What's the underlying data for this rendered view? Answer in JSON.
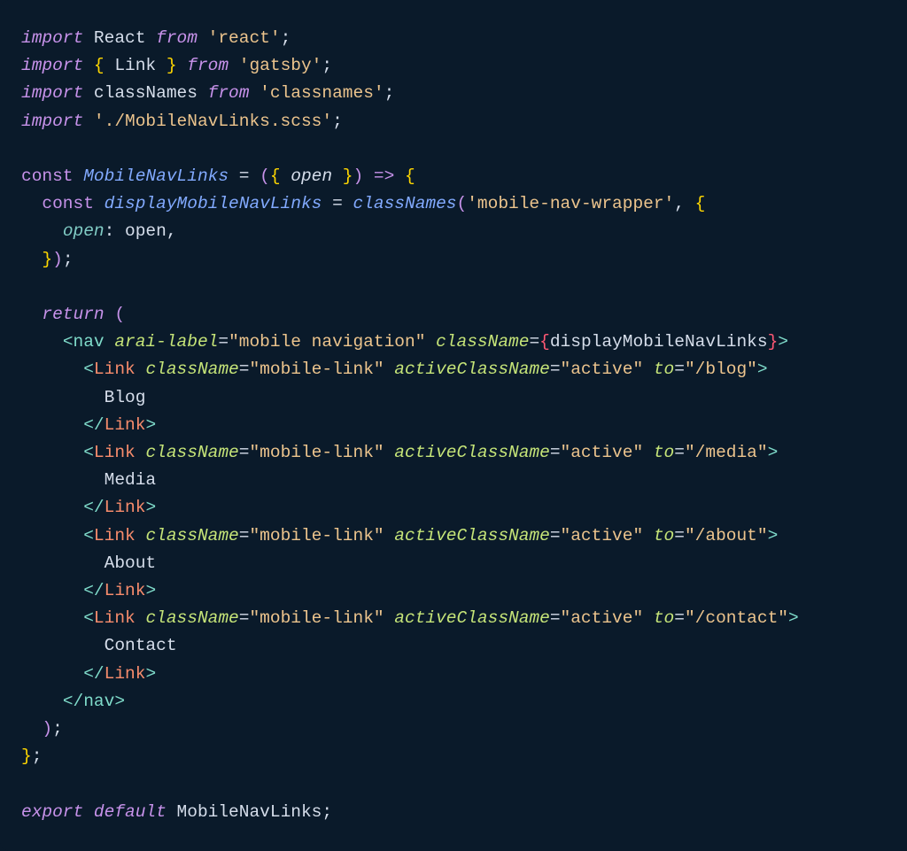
{
  "code": {
    "l1": {
      "kw_import": "import",
      "ident": "React",
      "kw_from": "from",
      "str": "'react'",
      "semi": ";"
    },
    "l2": {
      "kw_import": "import",
      "brace_o": "{",
      "ident": "Link",
      "brace_c": "}",
      "kw_from": "from",
      "str": "'gatsby'",
      "semi": ";"
    },
    "l3": {
      "kw_import": "import",
      "ident": "classNames",
      "kw_from": "from",
      "str": "'classnames'",
      "semi": ";"
    },
    "l4": {
      "kw_import": "import",
      "str": "'./MobileNavLinks.scss'",
      "semi": ";"
    },
    "l6": {
      "kw_const": "const",
      "fn": "MobileNavLinks",
      "eq": "=",
      "po": "(",
      "bo": "{",
      "param": "open",
      "bc": "}",
      "pc": ")",
      "arrow": "=>",
      "bo2": "{"
    },
    "l7": {
      "kw_const": "const",
      "fn": "displayMobileNavLinks",
      "eq": "=",
      "call": "classNames",
      "po": "(",
      "str": "'mobile-nav-wrapper'",
      "comma": ",",
      "bo": "{"
    },
    "l8": {
      "prop": "open",
      "colon": ":",
      "ident": "open",
      "comma": ","
    },
    "l9": {
      "bc": "}",
      "pc": ")",
      "semi": ";"
    },
    "l11": {
      "kw_return": "return",
      "po": "("
    },
    "l12": {
      "lt": "<",
      "tag": "nav",
      "attr1": "arai-label",
      "eq1": "=",
      "str1": "\"mobile navigation\"",
      "attr2": "className",
      "eq2": "=",
      "jbo": "{",
      "expr": "displayMobileNavLinks",
      "jbc": "}",
      "gt": ">"
    },
    "l13": {
      "lt": "<",
      "tag": "Link",
      "attr1": "className",
      "eq1": "=",
      "str1": "\"mobile-link\"",
      "attr2": "activeClassName",
      "eq2": "=",
      "str2": "\"active\"",
      "attr3": "to",
      "eq3": "=",
      "str3": "\"/blog\"",
      "gt": ">"
    },
    "l14": {
      "text": "Blog"
    },
    "l15": {
      "lt": "</",
      "tag": "Link",
      "gt": ">"
    },
    "l16": {
      "lt": "<",
      "tag": "Link",
      "attr1": "className",
      "eq1": "=",
      "str1": "\"mobile-link\"",
      "attr2": "activeClassName",
      "eq2": "=",
      "str2": "\"active\"",
      "attr3": "to",
      "eq3": "=",
      "str3": "\"/media\"",
      "gt": ">"
    },
    "l17": {
      "text": "Media"
    },
    "l18": {
      "lt": "</",
      "tag": "Link",
      "gt": ">"
    },
    "l19": {
      "lt": "<",
      "tag": "Link",
      "attr1": "className",
      "eq1": "=",
      "str1": "\"mobile-link\"",
      "attr2": "activeClassName",
      "eq2": "=",
      "str2": "\"active\"",
      "attr3": "to",
      "eq3": "=",
      "str3": "\"/about\"",
      "gt": ">"
    },
    "l20": {
      "text": "About"
    },
    "l21": {
      "lt": "</",
      "tag": "Link",
      "gt": ">"
    },
    "l22": {
      "lt": "<",
      "tag": "Link",
      "attr1": "className",
      "eq1": "=",
      "str1": "\"mobile-link\"",
      "attr2": "activeClassName",
      "eq2": "=",
      "str2": "\"active\"",
      "attr3": "to",
      "eq3": "=",
      "str3": "\"/contact\"",
      "gt": ">"
    },
    "l23": {
      "text": "Contact"
    },
    "l24": {
      "lt": "</",
      "tag": "Link",
      "gt": ">"
    },
    "l25": {
      "lt": "</",
      "tag": "nav",
      "gt": ">"
    },
    "l26": {
      "pc": ")",
      "semi": ";"
    },
    "l27": {
      "bc": "}",
      "semi": ";"
    },
    "l29": {
      "kw_export": "export",
      "kw_default": "default",
      "ident": "MobileNavLinks",
      "semi": ";"
    }
  }
}
